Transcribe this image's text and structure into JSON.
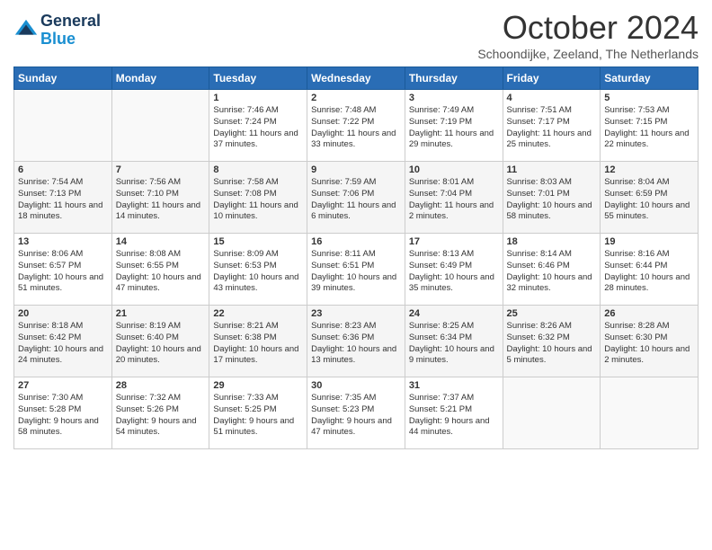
{
  "header": {
    "logo_line1": "General",
    "logo_line2": "Blue",
    "month": "October 2024",
    "location": "Schoondijke, Zeeland, The Netherlands"
  },
  "days_of_week": [
    "Sunday",
    "Monday",
    "Tuesday",
    "Wednesday",
    "Thursday",
    "Friday",
    "Saturday"
  ],
  "weeks": [
    [
      {
        "day": "",
        "text": ""
      },
      {
        "day": "",
        "text": ""
      },
      {
        "day": "1",
        "text": "Sunrise: 7:46 AM\nSunset: 7:24 PM\nDaylight: 11 hours and 37 minutes."
      },
      {
        "day": "2",
        "text": "Sunrise: 7:48 AM\nSunset: 7:22 PM\nDaylight: 11 hours and 33 minutes."
      },
      {
        "day": "3",
        "text": "Sunrise: 7:49 AM\nSunset: 7:19 PM\nDaylight: 11 hours and 29 minutes."
      },
      {
        "day": "4",
        "text": "Sunrise: 7:51 AM\nSunset: 7:17 PM\nDaylight: 11 hours and 25 minutes."
      },
      {
        "day": "5",
        "text": "Sunrise: 7:53 AM\nSunset: 7:15 PM\nDaylight: 11 hours and 22 minutes."
      }
    ],
    [
      {
        "day": "6",
        "text": "Sunrise: 7:54 AM\nSunset: 7:13 PM\nDaylight: 11 hours and 18 minutes."
      },
      {
        "day": "7",
        "text": "Sunrise: 7:56 AM\nSunset: 7:10 PM\nDaylight: 11 hours and 14 minutes."
      },
      {
        "day": "8",
        "text": "Sunrise: 7:58 AM\nSunset: 7:08 PM\nDaylight: 11 hours and 10 minutes."
      },
      {
        "day": "9",
        "text": "Sunrise: 7:59 AM\nSunset: 7:06 PM\nDaylight: 11 hours and 6 minutes."
      },
      {
        "day": "10",
        "text": "Sunrise: 8:01 AM\nSunset: 7:04 PM\nDaylight: 11 hours and 2 minutes."
      },
      {
        "day": "11",
        "text": "Sunrise: 8:03 AM\nSunset: 7:01 PM\nDaylight: 10 hours and 58 minutes."
      },
      {
        "day": "12",
        "text": "Sunrise: 8:04 AM\nSunset: 6:59 PM\nDaylight: 10 hours and 55 minutes."
      }
    ],
    [
      {
        "day": "13",
        "text": "Sunrise: 8:06 AM\nSunset: 6:57 PM\nDaylight: 10 hours and 51 minutes."
      },
      {
        "day": "14",
        "text": "Sunrise: 8:08 AM\nSunset: 6:55 PM\nDaylight: 10 hours and 47 minutes."
      },
      {
        "day": "15",
        "text": "Sunrise: 8:09 AM\nSunset: 6:53 PM\nDaylight: 10 hours and 43 minutes."
      },
      {
        "day": "16",
        "text": "Sunrise: 8:11 AM\nSunset: 6:51 PM\nDaylight: 10 hours and 39 minutes."
      },
      {
        "day": "17",
        "text": "Sunrise: 8:13 AM\nSunset: 6:49 PM\nDaylight: 10 hours and 35 minutes."
      },
      {
        "day": "18",
        "text": "Sunrise: 8:14 AM\nSunset: 6:46 PM\nDaylight: 10 hours and 32 minutes."
      },
      {
        "day": "19",
        "text": "Sunrise: 8:16 AM\nSunset: 6:44 PM\nDaylight: 10 hours and 28 minutes."
      }
    ],
    [
      {
        "day": "20",
        "text": "Sunrise: 8:18 AM\nSunset: 6:42 PM\nDaylight: 10 hours and 24 minutes."
      },
      {
        "day": "21",
        "text": "Sunrise: 8:19 AM\nSunset: 6:40 PM\nDaylight: 10 hours and 20 minutes."
      },
      {
        "day": "22",
        "text": "Sunrise: 8:21 AM\nSunset: 6:38 PM\nDaylight: 10 hours and 17 minutes."
      },
      {
        "day": "23",
        "text": "Sunrise: 8:23 AM\nSunset: 6:36 PM\nDaylight: 10 hours and 13 minutes."
      },
      {
        "day": "24",
        "text": "Sunrise: 8:25 AM\nSunset: 6:34 PM\nDaylight: 10 hours and 9 minutes."
      },
      {
        "day": "25",
        "text": "Sunrise: 8:26 AM\nSunset: 6:32 PM\nDaylight: 10 hours and 5 minutes."
      },
      {
        "day": "26",
        "text": "Sunrise: 8:28 AM\nSunset: 6:30 PM\nDaylight: 10 hours and 2 minutes."
      }
    ],
    [
      {
        "day": "27",
        "text": "Sunrise: 7:30 AM\nSunset: 5:28 PM\nDaylight: 9 hours and 58 minutes."
      },
      {
        "day": "28",
        "text": "Sunrise: 7:32 AM\nSunset: 5:26 PM\nDaylight: 9 hours and 54 minutes."
      },
      {
        "day": "29",
        "text": "Sunrise: 7:33 AM\nSunset: 5:25 PM\nDaylight: 9 hours and 51 minutes."
      },
      {
        "day": "30",
        "text": "Sunrise: 7:35 AM\nSunset: 5:23 PM\nDaylight: 9 hours and 47 minutes."
      },
      {
        "day": "31",
        "text": "Sunrise: 7:37 AM\nSunset: 5:21 PM\nDaylight: 9 hours and 44 minutes."
      },
      {
        "day": "",
        "text": ""
      },
      {
        "day": "",
        "text": ""
      }
    ]
  ]
}
